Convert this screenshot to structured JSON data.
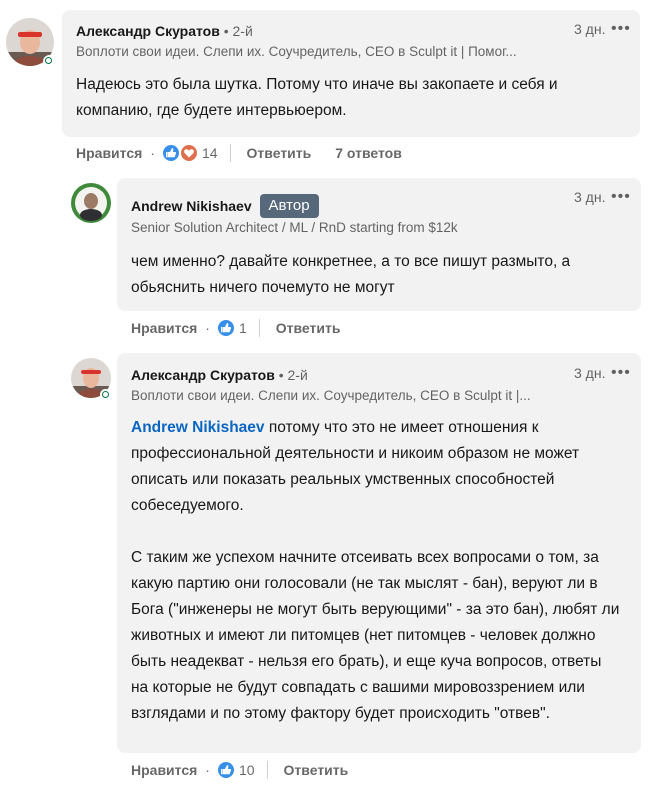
{
  "comments": [
    {
      "author": "Александр Скуратов",
      "degree": "• 2-й",
      "headline": "Воплоти свои идеи. Слепи их. Соучредитель, CEO в Sculpt it | Помог...",
      "time": "3 дн.",
      "text": "Надеюсь это была шутка. Потому что иначе вы закопаете и себя и компанию, где будете интервьюером.",
      "like_label": "Нравится",
      "reaction_count": "14",
      "reply_label": "Ответить",
      "replies_label": "7 ответов"
    },
    {
      "author": "Andrew Nikishaev",
      "badge": "Автор",
      "headline": "Senior Solution Architect / ML / RnD starting from $12k",
      "time": "3 дн.",
      "text": "чем именно? давайте конкретнее, а то все пишут размыто, а обьяснить ничего почемуто не могут",
      "like_label": "Нравится",
      "reaction_count": "1",
      "reply_label": "Ответить"
    },
    {
      "author": "Александр Скуратов",
      "degree": "• 2-й",
      "headline": "Воплоти свои идеи. Слепи их. Соучредитель, CEO в Sculpt it |...",
      "time": "3 дн.",
      "mention": "Andrew Nikishaev",
      "text_p1": " потому что это не имеет отношения к профессиональной деятельности и никоим образом не может описать или показать реальных умственных способностей собеседуемого.",
      "text_p2": "С таким же успехом начните отсеивать всех вопросами о том, за какую партию они голосовали (не так мыслят - бан), веруют ли в Бога (\"инженеры не могут быть верующими\" - за это бан), любят ли животных и имеют ли питомцев (нет питомцев - человек должно быть неадекват - нельзя его брать), и еще куча вопросов, ответы на которые не будут совпадать с вашими мировоззрением или взглядами и по этому фактору будет происходить \"отвев\".",
      "like_label": "Нравится",
      "reaction_count": "10",
      "reply_label": "Ответить"
    }
  ],
  "icons": {
    "more": "more-dots-icon",
    "like": "like-reaction-icon",
    "love": "love-reaction-icon"
  },
  "colors": {
    "bubble": "#f2f2f2",
    "mention": "#0a66c2",
    "badge": "#56687a",
    "like_blue": "#378fe9",
    "love_red": "#df704d",
    "online": "#057642"
  }
}
